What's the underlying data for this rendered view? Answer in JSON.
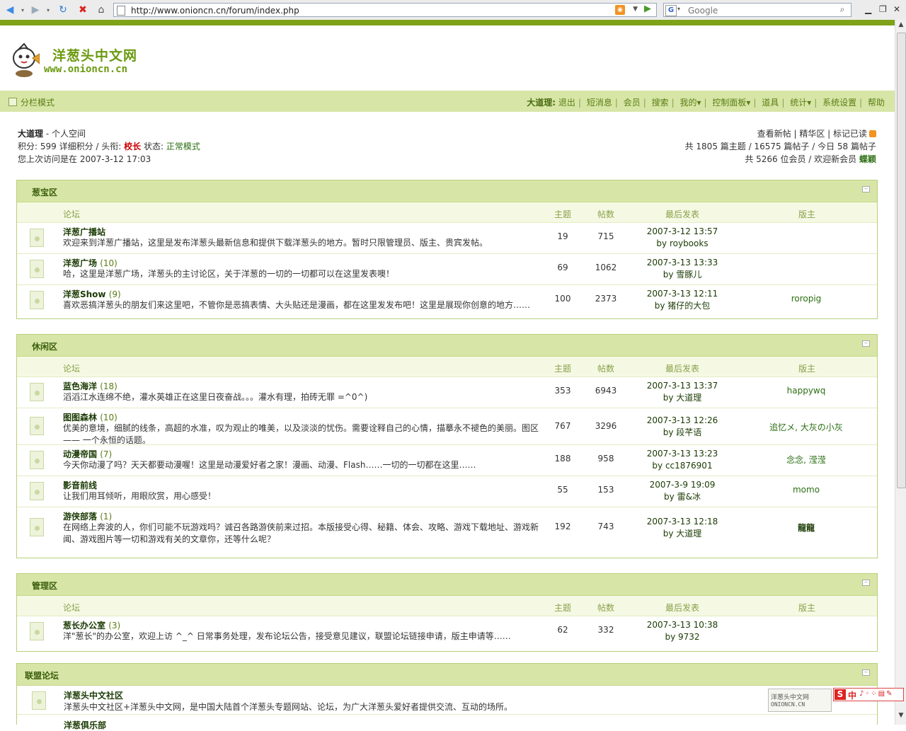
{
  "browser": {
    "url": "http://www.onioncn.cn/forum/index.php",
    "search_placeholder": "Google"
  },
  "header": {
    "site_name": "洋葱头中文网",
    "site_domain": "www.onioncn.cn"
  },
  "nav": {
    "mode": "分栏模式",
    "user": "大道理:",
    "links": [
      "退出",
      "短消息",
      "会员",
      "搜索",
      "我的▾",
      "控制面板▾",
      "道具",
      "统计▾",
      "系统设置",
      "帮助"
    ]
  },
  "user_info": {
    "name": "大道理",
    "space": "- 个人空间",
    "points_label": "积分: 599 详细积分 / 头衔:",
    "title": "校长",
    "status_label": "状态:",
    "status": "正常模式",
    "last_visit": "您上次访问是在 2007-3-12 17:03"
  },
  "stats": {
    "links": "查看新帖 | 精华区 | 标记已读",
    "line1": "共 1805 篇主题 / 16575 篇帖子 / 今日 58 篇帖子",
    "line2_prefix": "共 5266 位会员 / 欢迎新会员",
    "newest_member": "蝶颖"
  },
  "columns": {
    "forum": "论坛",
    "topics": "主题",
    "posts": "帖数",
    "last_post": "最后发表",
    "moderator": "版主"
  },
  "sections": [
    {
      "title": "葱宝区",
      "forums": [
        {
          "name": "洋葱广播站",
          "count": "",
          "desc": "欢迎来到洋葱广播站，这里是发布洋葱头最新信息和提供下载洋葱头的地方。暂时只限管理员、版主、贵宾发帖。",
          "topics": "19",
          "posts": "715",
          "last_date": "2007-3-12 13:57",
          "last_by": "by roybooks",
          "mod": ""
        },
        {
          "name": "洋葱广场",
          "count": "(10)",
          "desc": "哈，这里是洋葱广场，洋葱头的主讨论区，关于洋葱的一切的一切都可以在这里发表噢！",
          "topics": "69",
          "posts": "1062",
          "last_date": "2007-3-13 13:33",
          "last_by": "by 雪豚儿",
          "mod": ""
        },
        {
          "name": "洋葱Show",
          "count": "(9)",
          "desc": "喜欢恶搞洋葱头的朋友们来这里吧，不管你是恶搞表情、大头贴还是漫画，都在这里发发布吧！这里是展现你创意的地方……",
          "topics": "100",
          "posts": "2373",
          "last_date": "2007-3-13 12:11",
          "last_by": "by 猪仔的大包",
          "mod": "roropig"
        }
      ]
    },
    {
      "title": "休闲区",
      "forums": [
        {
          "name": "蓝色海洋",
          "count": "(18)",
          "desc": "滔滔江水连绵不绝，灌水英雄正在这里日夜奋战。。。灌水有理，拍砖无罪 =^0^)",
          "topics": "353",
          "posts": "6943",
          "last_date": "2007-3-13 13:37",
          "last_by": "by 大道理",
          "mod": "happywq"
        },
        {
          "name": "图图森林",
          "count": "(10)",
          "desc": "优美的意境，细腻的线条，高超的水准，叹为观止的唯美，以及淡淡的忧伤。需要诠释自己的心情，描摹永不褪色的美丽。图区 —— 一个永恒的话题。",
          "topics": "767",
          "posts": "3296",
          "last_date": "2007-3-13 12:26",
          "last_by": "by 段芊语",
          "mod": "追忆メ, 大灰の小灰"
        },
        {
          "name": "动漫帝国",
          "count": "(7)",
          "desc": "今天你动漫了吗？天天都要动漫喔！这里是动漫爱好者之家！漫画、动漫、Flash……一切的一切都在这里……",
          "topics": "188",
          "posts": "958",
          "last_date": "2007-3-13 13:23",
          "last_by": "by cc1876901",
          "mod": "念念, 滢滢"
        },
        {
          "name": "影音前线",
          "count": "",
          "desc": "让我们用耳倾听，用眼欣赏，用心感受！",
          "topics": "55",
          "posts": "153",
          "last_date": "2007-3-9 19:09",
          "last_by": "by 雷&冰",
          "mod": "momo"
        },
        {
          "name": "游侠部落",
          "count": "(1)",
          "desc": "在网络上奔波的人，你们可能不玩游戏吗？诚召各路游侠前来过招。本版接受心得、秘籍、体会、攻略、游戏下载地址、游戏新闻、游戏图片等一切和游戏有关的文章你，还等什么呢？",
          "topics": "192",
          "posts": "743",
          "last_date": "2007-3-13 12:18",
          "last_by": "by 大道理",
          "mod": "龍龍"
        }
      ]
    },
    {
      "title": "管理区",
      "forums": [
        {
          "name": "葱长办公室",
          "count": "(3)",
          "desc": "洋\"葱长\"的办公室，欢迎上访 ^_^ 日常事务处理，发布论坛公告，接受意见建议，联盟论坛链接申请，版主申请等……",
          "topics": "62",
          "posts": "332",
          "last_date": "2007-3-13 10:38",
          "last_by": "by 9732",
          "mod": ""
        }
      ]
    },
    {
      "title": "联盟论坛",
      "forums": [
        {
          "name": "洋葱头中文社区",
          "desc": "洋葱头中文社区+洋葱头中文网，是中国大陆首个洋葱头专题网站、论坛，为广大洋葱头爱好者提供交流、互动的场所。"
        },
        {
          "name": "洋葱俱乐部"
        }
      ]
    }
  ],
  "floating": {
    "partner_line1": "洋葱头中文网",
    "partner_line2": "ONIONCN.CN",
    "ime_s": "S",
    "ime_zh": "中",
    "ime_rest": "♪◦⁘▤✎"
  }
}
